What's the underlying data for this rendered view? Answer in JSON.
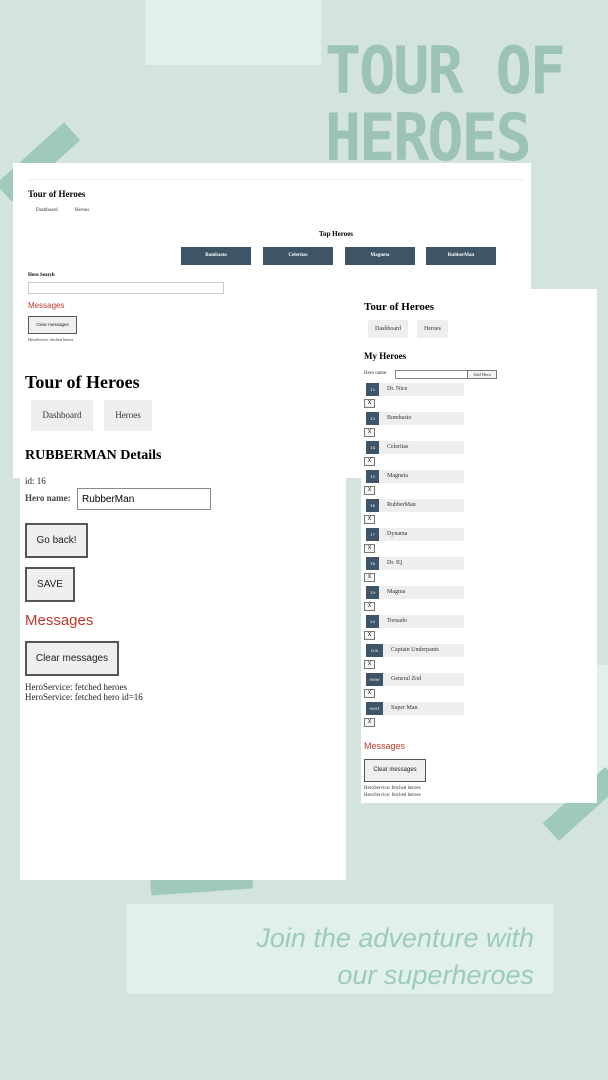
{
  "poster": {
    "title_line1": "TOUR OF",
    "title_line2": "HEROES",
    "tagline_line1": "Join the adventure with",
    "tagline_line2": "our superheroes"
  },
  "dashboard_shot": {
    "app_title": "Tour of Heroes",
    "nav": [
      "Dashboard",
      "Heroes"
    ],
    "top_heroes_title": "Top Heroes",
    "top_heroes": [
      "Bombasto",
      "Celeritas",
      "Magneta",
      "RubberMan"
    ],
    "hero_search_label": "Hero Search",
    "messages_title": "Messages",
    "clear_label": "Clear messages",
    "log": [
      "HeroService: fetched heroes"
    ]
  },
  "detail_shot": {
    "app_title": "Tour of Heroes",
    "nav": [
      "Dashboard",
      "Heroes"
    ],
    "details_title": "RUBBERMAN Details",
    "id_text": "id: 16",
    "name_label": "Hero name:",
    "name_value": "RubberMan",
    "go_back_label": "Go back!",
    "save_label": "SAVE",
    "messages_title": "Messages",
    "clear_label": "Clear messages",
    "log": [
      "HeroService: fetched heroes",
      "HeroService: fetched hero id=16"
    ]
  },
  "heroes_shot": {
    "app_title": "Tour of Heroes",
    "nav": [
      "Dashboard",
      "Heroes"
    ],
    "my_heroes_title": "My Heroes",
    "name_label": "Hero name:",
    "add_label": "Add Hero",
    "heroes": [
      {
        "id": "12",
        "name": "Dr. Nice"
      },
      {
        "id": "13",
        "name": "Bombasto"
      },
      {
        "id": "14",
        "name": "Celeritas"
      },
      {
        "id": "15",
        "name": "Magneta"
      },
      {
        "id": "16",
        "name": "RubberMan"
      },
      {
        "id": "17",
        "name": "Dynama"
      },
      {
        "id": "18",
        "name": "Dr. IQ"
      },
      {
        "id": "19",
        "name": "Magma"
      },
      {
        "id": "20",
        "name": "Tornado"
      },
      {
        "id": "100",
        "name": "Captain Underpants"
      },
      {
        "id": "9000",
        "name": "General Zod"
      },
      {
        "id": "9001",
        "name": "Super Man"
      }
    ],
    "delete_label": "X",
    "messages_title": "Messages",
    "clear_label": "Clear messages",
    "log": [
      "HeroService: fetched heroes",
      "HeroService: fetched heroes"
    ]
  },
  "colors": {
    "background": "#d2e4dd",
    "accent": "#9fc9bc",
    "button_dark": "#3d5566",
    "messages_red": "#c0392b"
  }
}
